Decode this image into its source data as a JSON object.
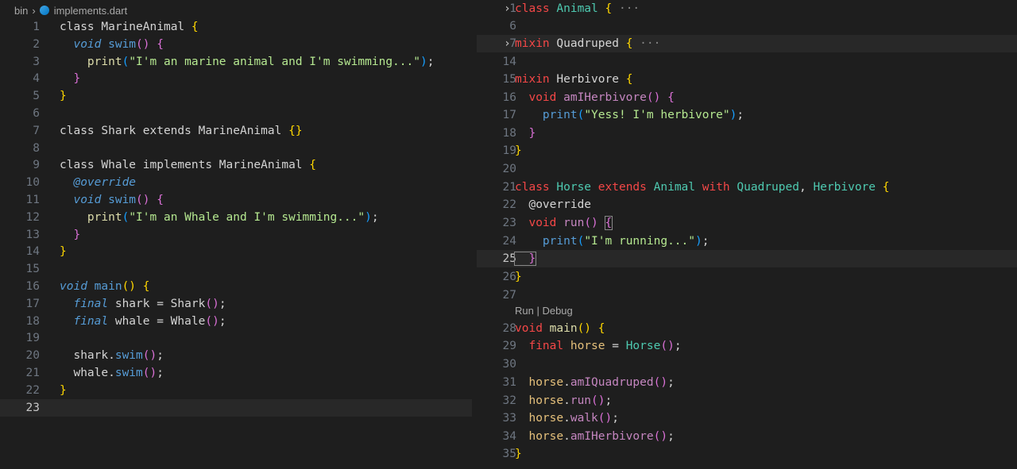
{
  "breadcrumb": {
    "folder": "bin",
    "file": "implements.dart"
  },
  "left_editor": {
    "lines": [
      {
        "n": "1",
        "segs": [
          [
            "kw",
            "class "
          ],
          [
            "kw",
            "MarineAnimal "
          ],
          [
            "p1",
            "{"
          ]
        ]
      },
      {
        "n": "2",
        "segs": [
          [
            "kwb",
            "  void "
          ],
          [
            "fnb",
            "swim"
          ],
          [
            "p2",
            "() {"
          ]
        ]
      },
      {
        "n": "3",
        "segs": [
          [
            "fnr",
            "    print"
          ],
          [
            "p3",
            "("
          ],
          [
            "strr",
            "\"I'm an marine animal and I'm swimming...\""
          ],
          [
            "p3",
            ")"
          ],
          [
            "kw",
            ";"
          ]
        ]
      },
      {
        "n": "4",
        "segs": [
          [
            "p2",
            "  }"
          ]
        ]
      },
      {
        "n": "5",
        "segs": [
          [
            "p1",
            "}"
          ]
        ]
      },
      {
        "n": "6",
        "segs": []
      },
      {
        "n": "7",
        "segs": [
          [
            "kw",
            "class Shark extends MarineAnimal "
          ],
          [
            "p1",
            "{}"
          ]
        ]
      },
      {
        "n": "8",
        "segs": []
      },
      {
        "n": "9",
        "segs": [
          [
            "kw",
            "class Whale implements MarineAnimal "
          ],
          [
            "p1",
            "{"
          ]
        ]
      },
      {
        "n": "10",
        "segs": [
          [
            "kwb",
            "  @override"
          ]
        ]
      },
      {
        "n": "11",
        "segs": [
          [
            "kwb",
            "  void "
          ],
          [
            "fnb",
            "swim"
          ],
          [
            "p2",
            "() {"
          ]
        ]
      },
      {
        "n": "12",
        "segs": [
          [
            "fnr",
            "    print"
          ],
          [
            "p3",
            "("
          ],
          [
            "strr",
            "\"I'm an Whale and I'm swimming...\""
          ],
          [
            "p3",
            ")"
          ],
          [
            "kw",
            ";"
          ]
        ]
      },
      {
        "n": "13",
        "segs": [
          [
            "p2",
            "  }"
          ]
        ]
      },
      {
        "n": "14",
        "segs": [
          [
            "p1",
            "}"
          ]
        ]
      },
      {
        "n": "15",
        "segs": []
      },
      {
        "n": "16",
        "segs": [
          [
            "kwb",
            "void "
          ],
          [
            "fnb",
            "main"
          ],
          [
            "p1",
            "() {"
          ]
        ]
      },
      {
        "n": "17",
        "segs": [
          [
            "kwb",
            "  final "
          ],
          [
            "kw",
            "shark = Shark"
          ],
          [
            "p2",
            "()"
          ],
          [
            "kw",
            ";"
          ]
        ]
      },
      {
        "n": "18",
        "segs": [
          [
            "kwb",
            "  final "
          ],
          [
            "kw",
            "whale = Whale"
          ],
          [
            "p2",
            "()"
          ],
          [
            "kw",
            ";"
          ]
        ]
      },
      {
        "n": "19",
        "segs": []
      },
      {
        "n": "20",
        "segs": [
          [
            "kw",
            "  shark."
          ],
          [
            "fnb",
            "swim"
          ],
          [
            "p2",
            "()"
          ],
          [
            "kw",
            ";"
          ]
        ]
      },
      {
        "n": "21",
        "segs": [
          [
            "kw",
            "  whale."
          ],
          [
            "fnb",
            "swim"
          ],
          [
            "p2",
            "()"
          ],
          [
            "kw",
            ";"
          ]
        ]
      },
      {
        "n": "22",
        "segs": [
          [
            "p1",
            "}"
          ]
        ]
      },
      {
        "n": "23",
        "segs": []
      }
    ]
  },
  "right_editor": {
    "codelens": "Run | Debug",
    "lines": [
      {
        "n": "1",
        "segs": [
          [
            "kwr",
            "class "
          ],
          [
            "ty",
            "Animal "
          ],
          [
            "p1",
            "{"
          ],
          [
            "fold",
            " ···"
          ]
        ]
      },
      {
        "n": "6",
        "segs": []
      },
      {
        "n": "7",
        "segs": [
          [
            "kwr",
            "mixin "
          ],
          [
            "kw",
            "Quadruped "
          ],
          [
            "p1",
            "{"
          ],
          [
            "fold",
            " ···"
          ]
        ]
      },
      {
        "n": "14",
        "segs": []
      },
      {
        "n": "15",
        "segs": [
          [
            "kwr",
            "mixin "
          ],
          [
            "kw",
            "Herbivore "
          ],
          [
            "p1",
            "{"
          ]
        ]
      },
      {
        "n": "16",
        "segs": [
          [
            "kwr",
            "  void "
          ],
          [
            "fn",
            "amIHerbivore"
          ],
          [
            "p2",
            "() {"
          ]
        ]
      },
      {
        "n": "17",
        "segs": [
          [
            "fnb",
            "    print"
          ],
          [
            "p3",
            "("
          ],
          [
            "strr",
            "\"Yess! I'm herbivore\""
          ],
          [
            "p3",
            ")"
          ],
          [
            "kw",
            ";"
          ]
        ]
      },
      {
        "n": "18",
        "segs": [
          [
            "p2",
            "  }"
          ]
        ]
      },
      {
        "n": "19",
        "segs": [
          [
            "p1",
            "}"
          ]
        ]
      },
      {
        "n": "20",
        "segs": []
      },
      {
        "n": "21",
        "segs": [
          [
            "kwr",
            "class "
          ],
          [
            "ty",
            "Horse "
          ],
          [
            "kwr",
            "extends "
          ],
          [
            "ty",
            "Animal "
          ],
          [
            "kwr",
            "with "
          ],
          [
            "ty",
            "Quadruped"
          ],
          [
            "kw",
            ", "
          ],
          [
            "ty",
            "Herbivore "
          ],
          [
            "p1",
            "{"
          ]
        ]
      },
      {
        "n": "22",
        "segs": [
          [
            "kw",
            "  @override"
          ]
        ]
      },
      {
        "n": "23",
        "segs": [
          [
            "kwr",
            "  void "
          ],
          [
            "fn",
            "run"
          ],
          [
            "p2",
            "() "
          ],
          [
            "p2",
            "{"
          ]
        ]
      },
      {
        "n": "24",
        "segs": [
          [
            "fnb",
            "    print"
          ],
          [
            "p3",
            "("
          ],
          [
            "strr",
            "\"I'm running...\""
          ],
          [
            "p3",
            ")"
          ],
          [
            "kw",
            ";"
          ]
        ]
      },
      {
        "n": "25",
        "segs": [
          [
            "p2",
            "  }"
          ]
        ]
      },
      {
        "n": "26",
        "segs": [
          [
            "p1",
            "}"
          ]
        ]
      },
      {
        "n": "27",
        "segs": []
      },
      {
        "n": "28",
        "segs": [
          [
            "kwr",
            "void "
          ],
          [
            "fnr",
            "main"
          ],
          [
            "p1",
            "() {"
          ]
        ]
      },
      {
        "n": "29",
        "segs": [
          [
            "kwr",
            "  final "
          ],
          [
            "id",
            "horse "
          ],
          [
            "kw",
            "= "
          ],
          [
            "ty",
            "Horse"
          ],
          [
            "p2",
            "()"
          ],
          [
            "kw",
            ";"
          ]
        ]
      },
      {
        "n": "30",
        "segs": []
      },
      {
        "n": "31",
        "segs": [
          [
            "id",
            "  horse"
          ],
          [
            "kw",
            "."
          ],
          [
            "fn",
            "amIQuadruped"
          ],
          [
            "p2",
            "()"
          ],
          [
            "kw",
            ";"
          ]
        ]
      },
      {
        "n": "32",
        "segs": [
          [
            "id",
            "  horse"
          ],
          [
            "kw",
            "."
          ],
          [
            "fn",
            "run"
          ],
          [
            "p2",
            "()"
          ],
          [
            "kw",
            ";"
          ]
        ]
      },
      {
        "n": "33",
        "segs": [
          [
            "id",
            "  horse"
          ],
          [
            "kw",
            "."
          ],
          [
            "fn",
            "walk"
          ],
          [
            "p2",
            "()"
          ],
          [
            "kw",
            ";"
          ]
        ]
      },
      {
        "n": "34",
        "segs": [
          [
            "id",
            "  horse"
          ],
          [
            "kw",
            "."
          ],
          [
            "fn",
            "amIHerbivore"
          ],
          [
            "p2",
            "()"
          ],
          [
            "kw",
            ";"
          ]
        ]
      },
      {
        "n": "35",
        "segs": [
          [
            "p1",
            "}"
          ]
        ]
      }
    ]
  },
  "colors": {
    "background": "#1e1e1e",
    "keyword_red": "#f44747",
    "type_teal": "#4ec9b0",
    "string_green": "#b5e890",
    "bracket_gold": "#ffd700",
    "bracket_pink": "#da70d6",
    "bracket_blue": "#179fff"
  }
}
